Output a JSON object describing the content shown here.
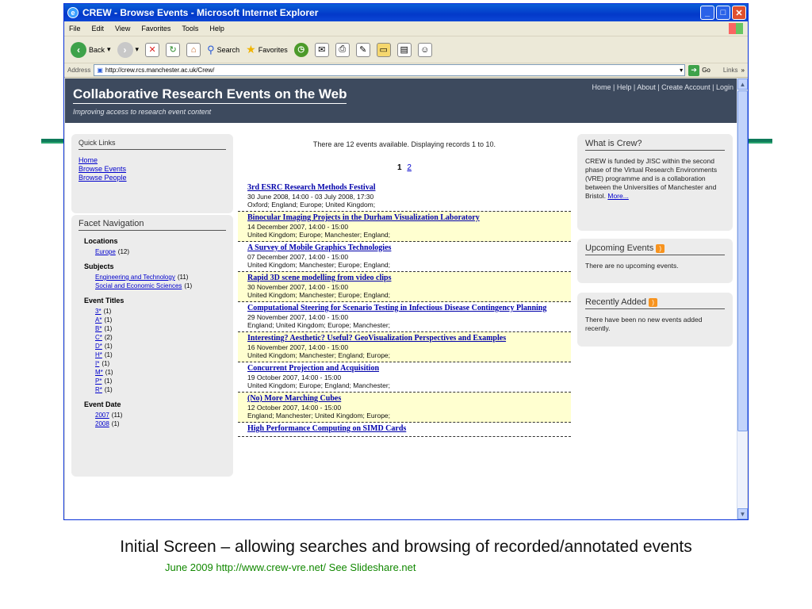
{
  "window": {
    "title": "CREW - Browse Events - Microsoft Internet Explorer"
  },
  "menu": [
    "File",
    "Edit",
    "View",
    "Favorites",
    "Tools",
    "Help"
  ],
  "toolbar": {
    "back": "Back",
    "search": "Search",
    "favorites": "Favorites"
  },
  "address": {
    "label": "Address",
    "url": "http://crew.rcs.manchester.ac.uk/Crew/",
    "go": "Go",
    "links": "Links"
  },
  "site": {
    "title": "Collaborative Research Events on the Web",
    "tagline": "Improving access to research event content",
    "nav": [
      "Home",
      "Help",
      "About",
      "Create Account",
      "Login"
    ]
  },
  "quick_links": {
    "title": "Quick Links",
    "items": [
      "Home",
      "Browse Events",
      "Browse People"
    ]
  },
  "facet": {
    "title": "Facet Navigation",
    "locations_label": "Locations",
    "locations": [
      {
        "name": "Europe",
        "count": "(12)"
      }
    ],
    "subjects_label": "Subjects",
    "subjects": [
      {
        "name": "Engineering and Technology",
        "count": "(11)"
      },
      {
        "name": "Social and Economic Sciences",
        "count": "(1)"
      }
    ],
    "titles_label": "Event Titles",
    "titles": [
      {
        "name": "3*",
        "count": "(1)"
      },
      {
        "name": "A*",
        "count": "(1)"
      },
      {
        "name": "B*",
        "count": "(1)"
      },
      {
        "name": "C*",
        "count": "(2)"
      },
      {
        "name": "D*",
        "count": "(1)"
      },
      {
        "name": "H*",
        "count": "(1)"
      },
      {
        "name": "I*",
        "count": "(1)"
      },
      {
        "name": "M*",
        "count": "(1)"
      },
      {
        "name": "P*",
        "count": "(1)"
      },
      {
        "name": "R*",
        "count": "(1)"
      }
    ],
    "date_label": "Event Date",
    "dates": [
      {
        "name": "2007",
        "count": "(11)"
      },
      {
        "name": "2008",
        "count": "(1)"
      }
    ]
  },
  "main": {
    "status": "There are 12 events available. Displaying records 1 to 10.",
    "pages": {
      "current": "1",
      "next": "2"
    },
    "events": [
      {
        "title": "3rd ESRC Research Methods Festival",
        "date": "30 June 2008, 14:00 - 03 July 2008, 17:30",
        "places": "Oxford; England; Europe; United Kingdom;"
      },
      {
        "title": "Binocular Imaging Projects in the Durham Visualization Laboratory",
        "date": "14 December 2007, 14:00 - 15:00",
        "places": "United Kingdom; Europe; Manchester; England;"
      },
      {
        "title": "A Survey of Mobile Graphics Technologies",
        "date": "07 December 2007, 14:00 - 15:00",
        "places": "United Kingdom; Manchester; Europe; England;"
      },
      {
        "title": "Rapid 3D scene modelling from video clips",
        "date": "30 November 2007, 14:00 - 15:00",
        "places": "United Kingdom; Manchester; Europe; England;"
      },
      {
        "title": "Computational Steering for Scenario Testing in Infectious Disease Contingency Planning",
        "date": "29 November 2007, 14:00 - 15:00",
        "places": "England; United Kingdom; Europe; Manchester;"
      },
      {
        "title": "Interesting? Aesthetic? Useful? GeoVisualization Perspectives and Examples",
        "date": "16 November 2007, 14:00 - 15:00",
        "places": "United Kingdom; Manchester; England; Europe;"
      },
      {
        "title": "Concurrent Projection and Acquisition",
        "date": "19 October 2007, 14:00 - 15:00",
        "places": "United Kingdom; Europe; England; Manchester;"
      },
      {
        "title": "(No) More Marching Cubes",
        "date": "12 October 2007, 14:00 - 15:00",
        "places": "England; Manchester; United Kingdom; Europe;"
      },
      {
        "title": "High Performance Computing on SIMD Cards",
        "date": "",
        "places": ""
      }
    ]
  },
  "right": {
    "what": {
      "title": "What is Crew?",
      "body": "CREW is funded by JISC within the second phase of the Virtual Research Environments (VRE) programme and is a collaboration between the Universities of Manchester and Bristol.",
      "more": "More..."
    },
    "upcoming": {
      "title": "Upcoming Events",
      "body": "There are no upcoming events."
    },
    "recent": {
      "title": "Recently Added",
      "body": "There have been no new events added recently."
    }
  },
  "caption": "Initial Screen – allowing searches and browsing of recorded/annotated events",
  "credit": "June 2009 http://www.crew-vre.net/ See Slideshare.net",
  "colors": {
    "header_bg": "#3d4a5e",
    "event_highlight": "#ffffd0",
    "credit_green": "#118800",
    "xp_blue": "#0339c9"
  }
}
